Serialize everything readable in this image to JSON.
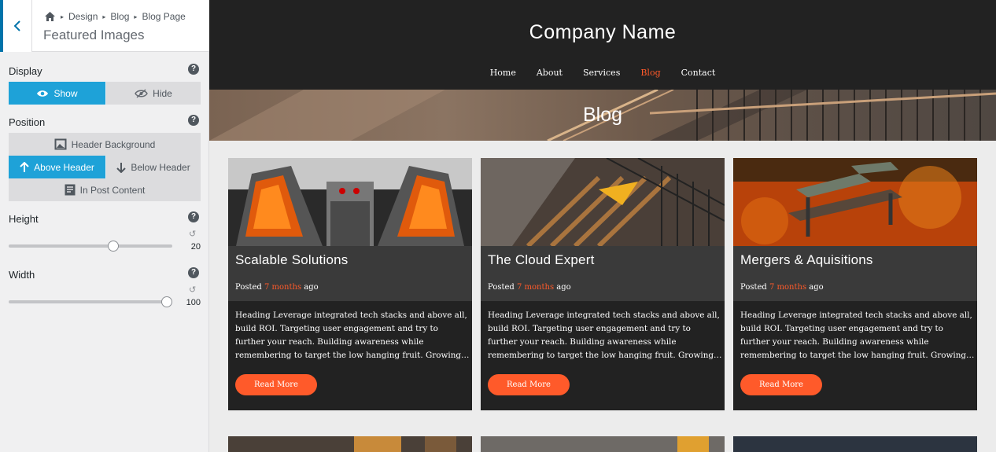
{
  "customizer": {
    "breadcrumb": [
      "Design",
      "Blog",
      "Blog Page"
    ],
    "title": "Featured Images",
    "display": {
      "label": "Display",
      "options": [
        "Show",
        "Hide"
      ],
      "selected": "Show"
    },
    "position": {
      "label": "Position",
      "options": [
        "Header Background",
        "Above Header",
        "Below Header",
        "In Post Content"
      ],
      "selected": "Above Header"
    },
    "height": {
      "label": "Height",
      "value": "20",
      "level": 0.65
    },
    "width": {
      "label": "Width",
      "value": "100",
      "level": 1.0
    },
    "accent": "#1ea2d8"
  },
  "site": {
    "company_name": "Company Name",
    "nav": [
      "Home",
      "About",
      "Services",
      "Blog",
      "Contact"
    ],
    "current_nav": "Blog",
    "hero_title": "Blog",
    "accent": "#ff5a2a",
    "posts": [
      {
        "title": "Scalable Solutions",
        "posted": "Posted",
        "ago_link": "7 months",
        "ago": "ago",
        "excerpt": "Heading Leverage integrated tech stacks and above all, build ROI. Targeting user engagement and try to further your reach. Building awareness while remembering to target the low hanging fruit. Growing…",
        "button": "Read More"
      },
      {
        "title": "The Cloud Expert",
        "posted": "Posted",
        "ago_link": "7 months",
        "ago": "ago",
        "excerpt": "Heading Leverage integrated tech stacks and above all, build ROI. Targeting user engagement and try to further your reach. Building awareness while remembering to target the low hanging fruit. Growing…",
        "button": "Read More"
      },
      {
        "title": "Mergers & Aquisitions",
        "posted": "Posted",
        "ago_link": "7 months",
        "ago": "ago",
        "excerpt": "Heading Leverage integrated tech stacks and above all, build ROI. Targeting user engagement and try to further your reach. Building awareness while remembering to target the low hanging fruit. Growing…",
        "button": "Read More"
      }
    ]
  }
}
